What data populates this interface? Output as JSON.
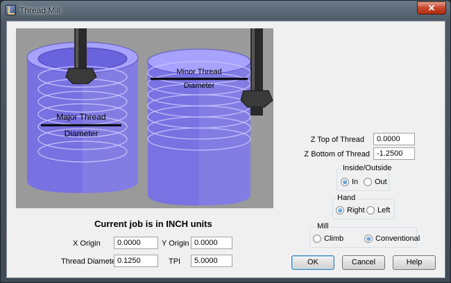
{
  "window": {
    "title": "Thread Mill",
    "close_glyph": "✕"
  },
  "images": {
    "left": {
      "line1": "Major Thread",
      "line2": "Diameter"
    },
    "right": {
      "line1": "Minor Thread",
      "line2": "Diameter"
    }
  },
  "units_caption": "Current job is in INCH units",
  "fields": {
    "x_origin": {
      "label": "X Origin",
      "value": "0.0000"
    },
    "y_origin": {
      "label": "Y Origin",
      "value": "0.0000"
    },
    "thread_diameter": {
      "label": "Thread Diameter",
      "value": "0.1250"
    },
    "tpi": {
      "label": "TPI",
      "value": "5.0000"
    },
    "z_top": {
      "label": "Z Top of Thread",
      "value": "0.0000"
    },
    "z_bottom": {
      "label": "Z Bottom of Thread",
      "value": "-1.2500"
    }
  },
  "groups": {
    "inside_outside": {
      "title": "Inside/Outside",
      "options": [
        "In",
        "Out"
      ],
      "selected": "In"
    },
    "hand": {
      "title": "Hand",
      "options": [
        "Right",
        "Left"
      ],
      "selected": "Right"
    },
    "mill": {
      "title": "Mill",
      "options": [
        "Climb",
        "Conventional"
      ],
      "selected": "Conventional"
    }
  },
  "buttons": {
    "ok": "OK",
    "cancel": "Cancel",
    "help": "Help"
  },
  "colors": {
    "cylinder": "#7f78f0",
    "tool": "#2a2a2a",
    "background": "#9a9a9a"
  }
}
